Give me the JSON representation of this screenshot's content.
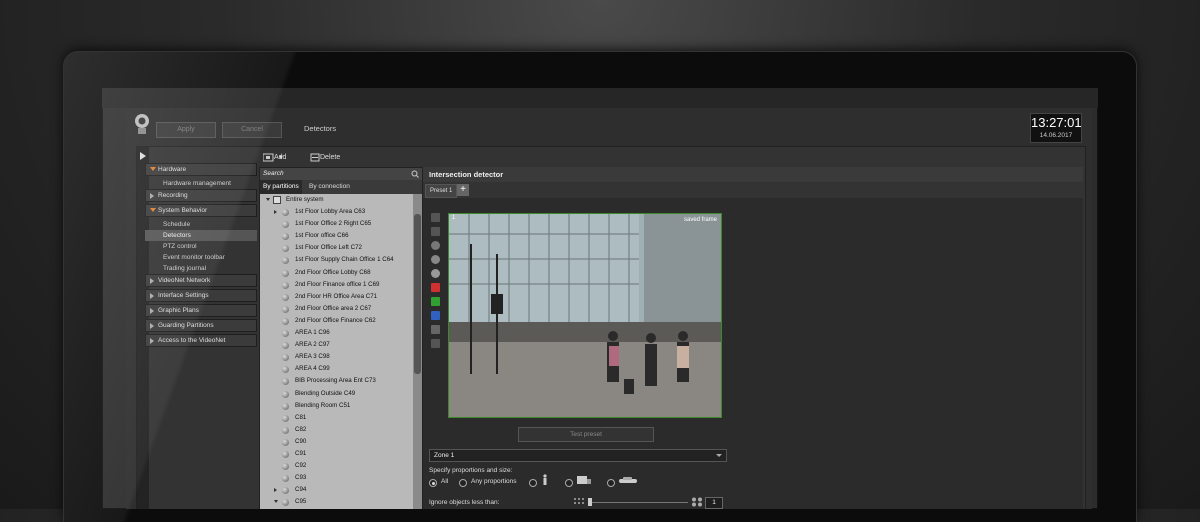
{
  "header": {
    "apply_label": "Apply",
    "cancel_label": "Cancel",
    "title": "Detectors",
    "time": "13:27:01",
    "date": "14.06.2017"
  },
  "toolbar": {
    "add_label": "Add",
    "delete_label": "Delete"
  },
  "nav": {
    "hardware": "Hardware",
    "hardware_items": [
      "Hardware management"
    ],
    "recording": "Recording",
    "system_behavior": "System Behavior",
    "system_items": [
      "Schedule",
      "Detectors",
      "PTZ control",
      "Event monitor toolbar",
      "Trading journal"
    ],
    "others": [
      "VideoNet Network",
      "Interface Settings",
      "Graphic Plans",
      "Guarding Partitions",
      "Access to the VideoNet"
    ]
  },
  "tree": {
    "search_placeholder": "Search",
    "tabs": [
      "By partitions",
      "By connection"
    ],
    "root": "Entire system",
    "items": [
      "1st Floor Lobby Area C63",
      "1st Floor Office 2 Right C65",
      "1st Floor office C66",
      "1st Floor Office Left C72",
      "1st Floor Supply Chain Office 1 C64",
      "2nd Floor  Office Lobby C68",
      "2nd Floor Finance office 1 C69",
      "2nd Floor HR Office Area C71",
      "2nd Floor Office area 2 C67",
      "2nd Floor Office Finance  C62",
      "AREA 1 C96",
      "AREA 2 C97",
      "AREA 3 C98",
      "AREA 4 C99",
      "BIB Processing Area Ent C73",
      "Blending Outside  C49",
      "Blending Room C51",
      "C81",
      "C82",
      "C90",
      "C91",
      "C92",
      "C93",
      "C94",
      "C95"
    ]
  },
  "panel": {
    "title": "Intersection detector",
    "preset": "Preset 1",
    "video_index": "1",
    "video_label": "saved frame",
    "test_preset": "Test preset",
    "zone": "Zone 1",
    "proportions_label": "Specify proportions and size:",
    "all_label": "All",
    "any_label": "Any proportions",
    "ignore_label": "Ignore objects less than:",
    "ignore_value": "1"
  },
  "colors": {
    "accent_orange": "#e08030",
    "zone_border": "#3a8a2a"
  }
}
